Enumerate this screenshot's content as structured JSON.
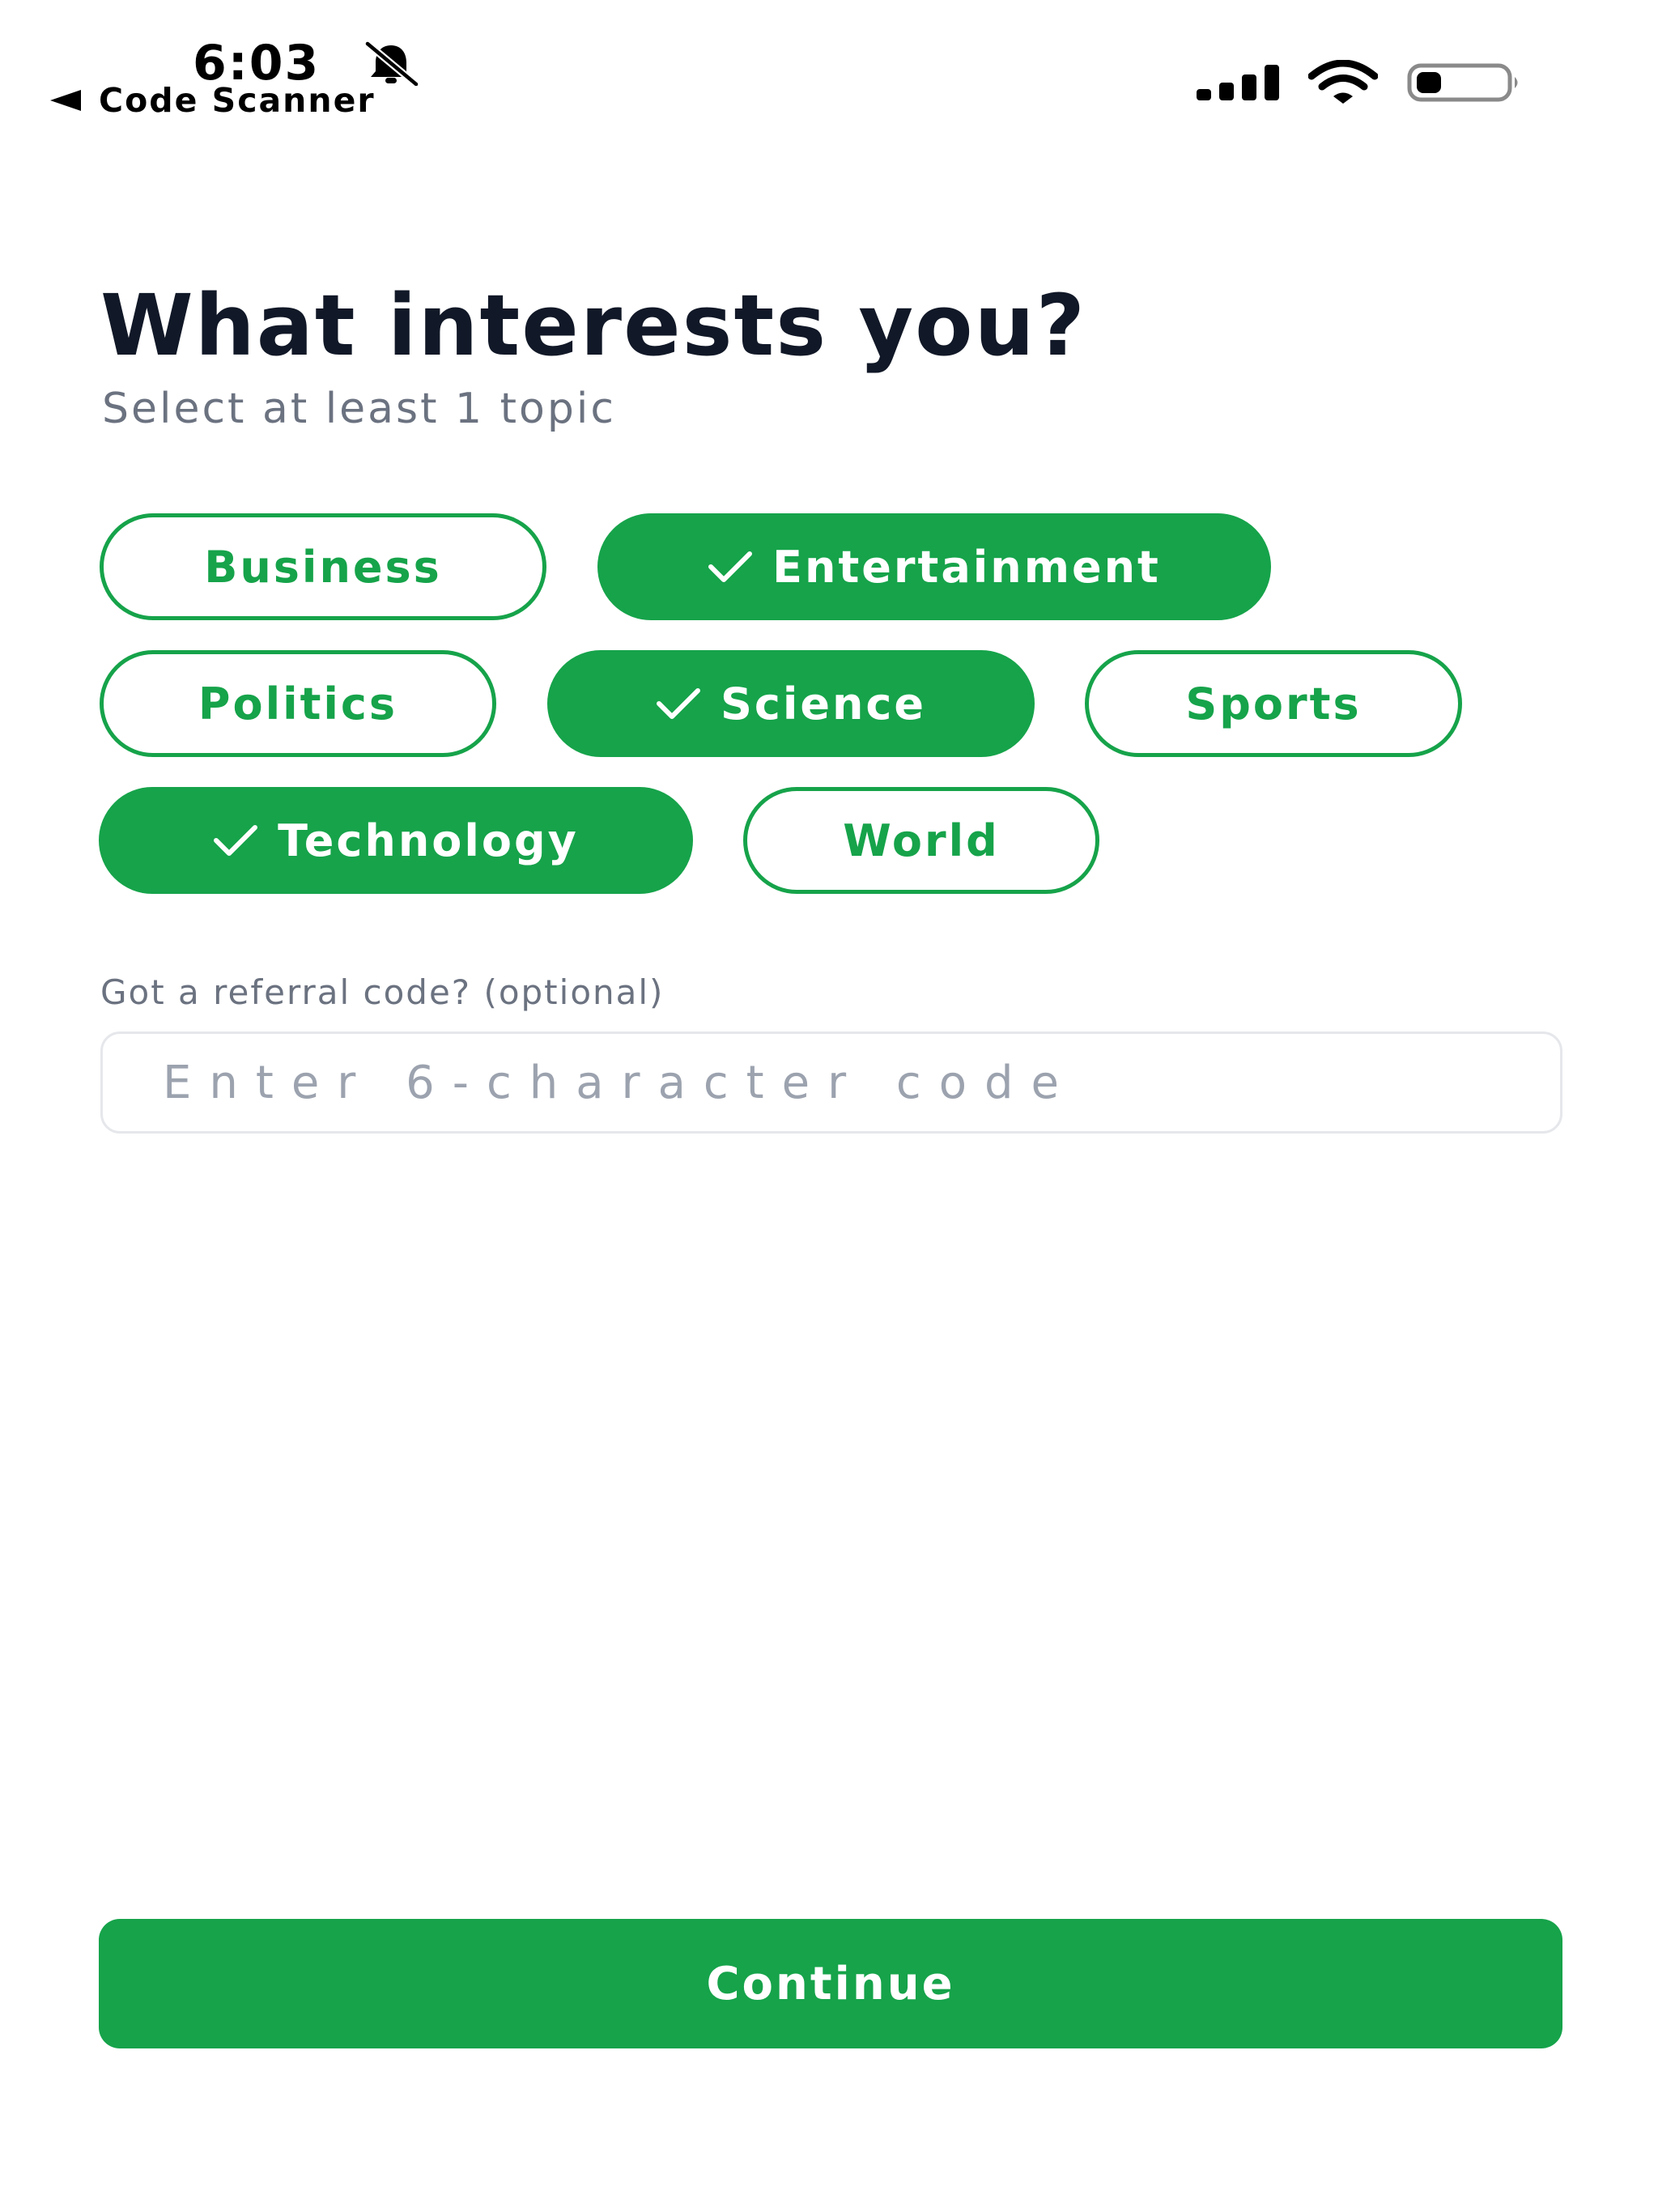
{
  "status_bar": {
    "time": "6:03",
    "back_app": "Code Scanner",
    "icons": [
      "bell-slash-icon",
      "signal-icon",
      "wifi-icon",
      "battery-icon"
    ]
  },
  "header": {
    "title": "What interests you?",
    "subtitle": "Select at least 1 topic"
  },
  "topics": {
    "business": {
      "label": "Business",
      "selected": false
    },
    "entertainment": {
      "label": "Entertainment",
      "selected": true
    },
    "politics": {
      "label": "Politics",
      "selected": false
    },
    "science": {
      "label": "Science",
      "selected": true
    },
    "sports": {
      "label": "Sports",
      "selected": false
    },
    "technology": {
      "label": "Technology",
      "selected": true
    },
    "world": {
      "label": "World",
      "selected": false
    }
  },
  "referral": {
    "label": "Got a referral code? (optional)",
    "placeholder": "Enter 6-character code",
    "value": ""
  },
  "continue_label": "Continue",
  "colors": {
    "accent": "#16a34a",
    "title": "#111827",
    "muted": "#6b7280",
    "placeholder": "#9ca3af",
    "border": "#e5e7eb"
  }
}
